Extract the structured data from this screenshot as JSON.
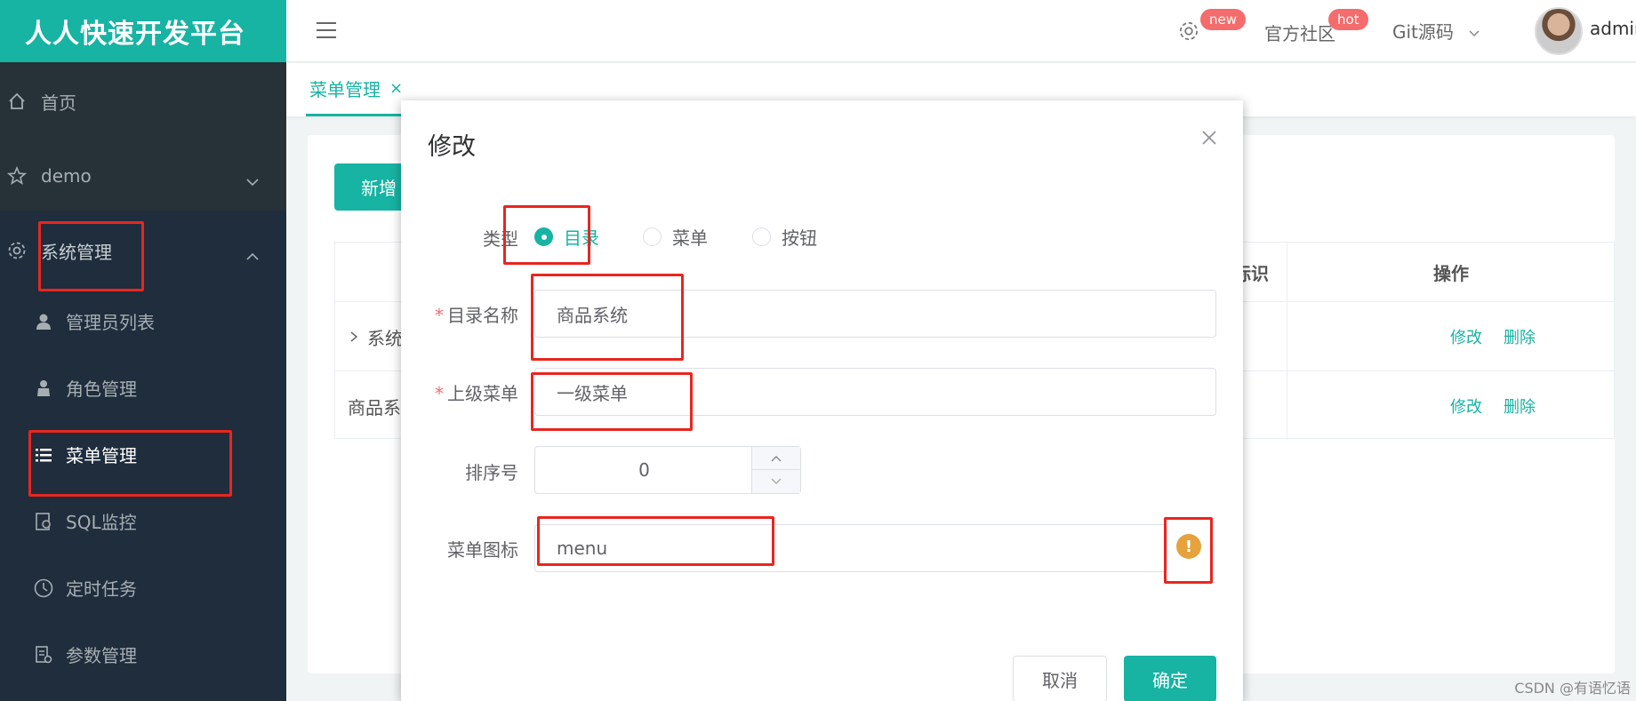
{
  "app": {
    "brand": "人人快速开发平台"
  },
  "sidebar": {
    "items": [
      {
        "label": "首页",
        "icon": "home-icon"
      },
      {
        "label": "demo",
        "icon": "star-icon"
      },
      {
        "label": "系统管理",
        "icon": "gear-icon"
      }
    ],
    "sub_items": [
      {
        "label": "管理员列表",
        "icon": "user-icon"
      },
      {
        "label": "角色管理",
        "icon": "role-icon"
      },
      {
        "label": "菜单管理",
        "icon": "list-icon"
      },
      {
        "label": "SQL监控",
        "icon": "sql-icon"
      },
      {
        "label": "定时任务",
        "icon": "clock-icon"
      },
      {
        "label": "参数管理",
        "icon": "config-icon"
      }
    ]
  },
  "topbar": {
    "badge_new": "new",
    "community": "官方社区",
    "badge_hot": "hot",
    "git": "Git源码",
    "user": "admin"
  },
  "tabs": [
    {
      "label": "菜单管理",
      "close": "×"
    }
  ],
  "page": {
    "add_button": "新增",
    "columns": {
      "auth": "授权标识",
      "ops": "操作"
    },
    "rows": [
      {
        "name": "系统",
        "edit": "修改",
        "delete": "删除"
      },
      {
        "name": "商品系",
        "edit": "修改",
        "delete": "删除"
      }
    ]
  },
  "modal": {
    "title": "修改",
    "type_label": "类型",
    "type_options": [
      "目录",
      "菜单",
      "按钮"
    ],
    "type_selected": "目录",
    "name_label": "目录名称",
    "name_value": "商品系统",
    "parent_label": "上级菜单",
    "parent_value": "一级菜单",
    "order_label": "排序号",
    "order_value": "0",
    "icon_label": "菜单图标",
    "icon_value": "menu",
    "warn_mark": "!",
    "cancel": "取消",
    "confirm": "确定"
  },
  "watermark": "CSDN @有语忆语",
  "colors": {
    "accent": "#17b3a3",
    "sidebar": "#263238",
    "annotation": "#e8261f",
    "warning": "#e6a23c"
  }
}
